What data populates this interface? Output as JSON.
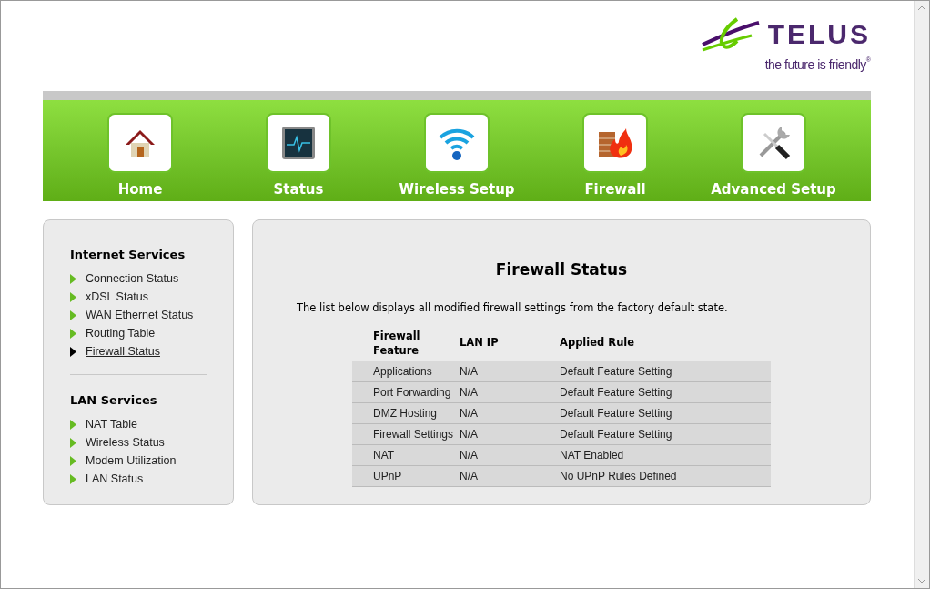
{
  "logo": {
    "name": "TELUS",
    "tagline": "the future is friendly",
    "mark": "®"
  },
  "nav": [
    {
      "label": "Home",
      "kind": "home"
    },
    {
      "label": "Status",
      "kind": "status"
    },
    {
      "label": "Wireless Setup",
      "kind": "wireless"
    },
    {
      "label": "Firewall",
      "kind": "firewall"
    },
    {
      "label": "Advanced Setup",
      "kind": "tools"
    }
  ],
  "sidebar": [
    {
      "heading": "Internet Services",
      "items": [
        {
          "label": "Connection Status",
          "selected": false
        },
        {
          "label": "xDSL Status",
          "selected": false
        },
        {
          "label": "WAN Ethernet Status",
          "selected": false
        },
        {
          "label": "Routing Table",
          "selected": false
        },
        {
          "label": "Firewall Status",
          "selected": true
        }
      ]
    },
    {
      "heading": "LAN Services",
      "items": [
        {
          "label": "NAT Table",
          "selected": false
        },
        {
          "label": "Wireless Status",
          "selected": false
        },
        {
          "label": "Modem Utilization",
          "selected": false
        },
        {
          "label": "LAN Status",
          "selected": false
        }
      ]
    }
  ],
  "main": {
    "title": "Firewall Status",
    "description": "The list below displays all modified firewall settings from the factory default state.",
    "table": {
      "columns": [
        "Firewall Feature",
        "LAN IP",
        "Applied Rule"
      ],
      "rows": [
        [
          "Applications",
          "N/A",
          "Default Feature Setting"
        ],
        [
          "Port Forwarding",
          "N/A",
          "Default Feature Setting"
        ],
        [
          "DMZ Hosting",
          "N/A",
          "Default Feature Setting"
        ],
        [
          "Firewall Settings",
          "N/A",
          "Default Feature Setting"
        ],
        [
          "NAT",
          "N/A",
          "NAT Enabled"
        ],
        [
          "UPnP",
          "N/A",
          "No UPnP Rules Defined"
        ]
      ]
    }
  }
}
